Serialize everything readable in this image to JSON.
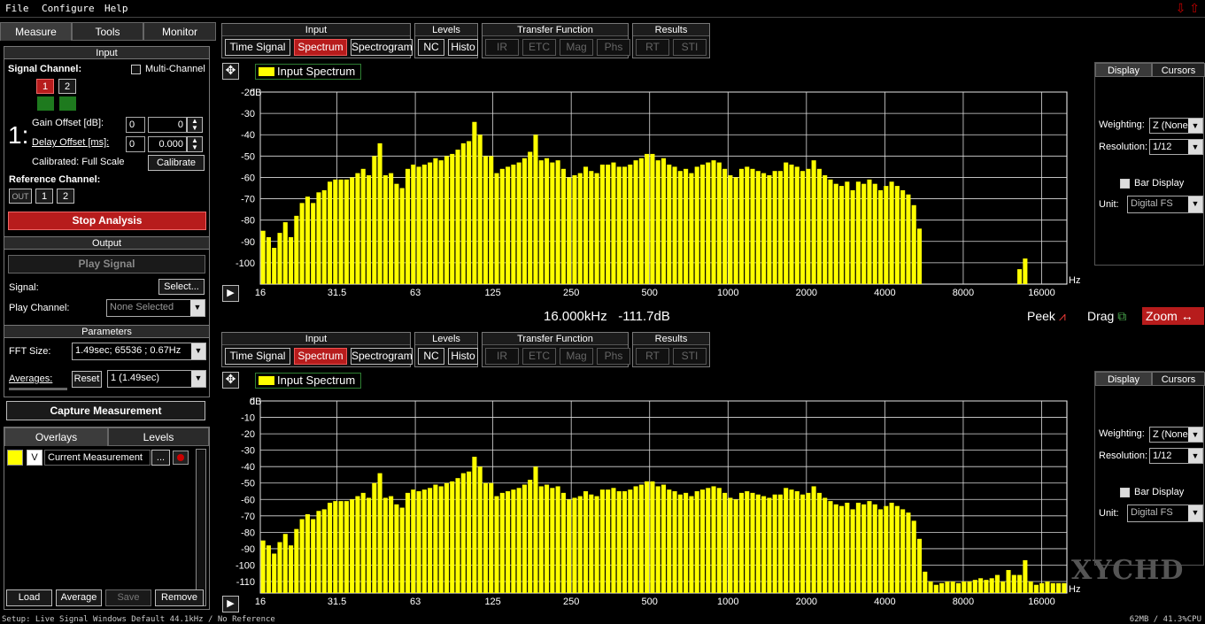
{
  "menu": [
    "File",
    "Configure",
    "Help"
  ],
  "left": {
    "tabs": [
      "Measure",
      "Tools",
      "Monitor"
    ],
    "input": {
      "header": "Input",
      "signal_channel": "Signal Channel:",
      "multi_channel": "Multi-Channel",
      "channels": [
        "1",
        "2"
      ],
      "channel_big": "1:",
      "gain_label": "Gain Offset [dB]:",
      "gain_a": "0",
      "gain_b": "0",
      "delay_label": "Delay Offset [ms]:",
      "delay_a": "0",
      "delay_b": "0.000",
      "calibrated": "Calibrated: Full Scale",
      "calibrate": "Calibrate",
      "reference_channel": "Reference Channel:",
      "ref_buttons": [
        "OUT",
        "1",
        "2"
      ],
      "stop": "Stop Analysis"
    },
    "output": {
      "header": "Output",
      "play": "Play Signal",
      "signal_label": "Signal:",
      "select": "Select...",
      "play_channel_label": "Play Channel:",
      "play_channel": "None Selected"
    },
    "parameters": {
      "header": "Parameters",
      "fft_label": "FFT Size:",
      "fft_value": "1.49sec; 65536 ; 0.67Hz",
      "averages_label": "Averages:",
      "reset": "Reset",
      "averages_value": "1  (1.49sec)",
      "capture": "Capture Measurement"
    },
    "overlays": {
      "tabs": [
        "Overlays",
        "Levels"
      ],
      "row_v": "V",
      "row_name": "Current Measurement",
      "row_more": "...",
      "buttons": [
        "Load",
        "Average",
        "Save",
        "Remove"
      ]
    }
  },
  "toolbar": {
    "groups": [
      {
        "title": "Input",
        "buttons": [
          {
            "label": "Time Signal",
            "state": "normal"
          },
          {
            "label": "Spectrum",
            "state": "on"
          },
          {
            "label": "Spectrogram",
            "state": "normal"
          }
        ]
      },
      {
        "title": "Levels",
        "buttons": [
          {
            "label": "NC",
            "state": "normal"
          },
          {
            "label": "Histo",
            "state": "normal"
          }
        ]
      },
      {
        "title": "Transfer Function",
        "buttons": [
          {
            "label": "IR",
            "state": "off"
          },
          {
            "label": "ETC",
            "state": "off"
          },
          {
            "label": "Mag",
            "state": "off"
          },
          {
            "label": "Phs",
            "state": "off"
          }
        ]
      },
      {
        "title": "Results",
        "buttons": [
          {
            "label": "RT",
            "state": "off"
          },
          {
            "label": "STI",
            "state": "off"
          }
        ]
      }
    ]
  },
  "right_panel": {
    "tabs": [
      "Display",
      "Cursors"
    ],
    "weighting_label": "Weighting:",
    "weighting": "Z (None)",
    "resolution_label": "Resolution:",
    "resolution": "1/12",
    "bar_display": "Bar Display",
    "unit_label": "Unit:",
    "unit": "Digital FS"
  },
  "readout": "16.000kHz   -111.7dB",
  "view_tools": {
    "peek": "Peek",
    "drag": "Drag",
    "zoom": "Zoom"
  },
  "watermark": "XYCHD",
  "status": {
    "left": "Setup: Live Signal Windows Default 44.1kHz / No Reference",
    "right": "62MB / 41.3%CPU"
  },
  "colors": {
    "bar": "#ffff00",
    "active": "#b71c1c",
    "legend_border": "#2e7d32"
  },
  "chart_data": [
    {
      "type": "bar",
      "legend": "Input Spectrum",
      "ylabel": "dB",
      "xlabel": "Hz",
      "x_scale": "log",
      "xlim": [
        16,
        20000
      ],
      "ylim": [
        -110,
        -20
      ],
      "y_ticks": [
        -20,
        -30,
        -40,
        -50,
        -60,
        -70,
        -80,
        -90,
        -100
      ],
      "x_ticks": [
        "16",
        "31.5",
        "63",
        "125",
        "250",
        "500",
        "1000",
        "2000",
        "4000",
        "8000",
        "16000"
      ],
      "x_tick_values": [
        16,
        31.5,
        63,
        125,
        250,
        500,
        1000,
        2000,
        4000,
        8000,
        16000
      ],
      "values": [
        -85,
        -88,
        -93,
        -86,
        -81,
        -88,
        -78,
        -72,
        -69,
        -72,
        -67,
        -66,
        -62,
        -61,
        -61,
        -61,
        -60,
        -58,
        -56,
        -59,
        -50,
        -44,
        -59,
        -58,
        -63,
        -65,
        -56,
        -54,
        -55,
        -54,
        -53,
        -51,
        -52,
        -50,
        -49,
        -47,
        -44,
        -43,
        -34,
        -40,
        -50,
        -50,
        -58,
        -56,
        -55,
        -54,
        -53,
        -51,
        -48,
        -40,
        -52,
        -51,
        -53,
        -52,
        -56,
        -60,
        -59,
        -58,
        -55,
        -57,
        -58,
        -54,
        -54,
        -53,
        -55,
        -55,
        -54,
        -52,
        -51,
        -49,
        -49,
        -52,
        -51,
        -54,
        -55,
        -57,
        -56,
        -58,
        -55,
        -54,
        -53,
        -52,
        -53,
        -56,
        -59,
        -60,
        -56,
        -55,
        -56,
        -57,
        -58,
        -59,
        -57,
        -57,
        -53,
        -54,
        -55,
        -57,
        -56,
        -52,
        -56,
        -59,
        -61,
        -63,
        -64,
        -62,
        -66,
        -62,
        -63,
        -61,
        -63,
        -66,
        -64,
        -62,
        -64,
        -66,
        -68,
        -73,
        -84,
        -110,
        -110,
        -110,
        -110,
        -110,
        -110,
        -110,
        -110,
        -110,
        -110,
        -110,
        -110,
        -110,
        -110,
        -110,
        -111,
        -111,
        -103,
        -98,
        -111,
        -111,
        -111,
        -111,
        -111,
        -111,
        -111
      ]
    },
    {
      "type": "bar",
      "legend": "Input Spectrum",
      "ylabel": "dB",
      "xlabel": "Hz",
      "x_scale": "log",
      "xlim": [
        16,
        20000
      ],
      "ylim": [
        -117,
        0
      ],
      "y_ticks": [
        0,
        -10,
        -20,
        -30,
        -40,
        -50,
        -60,
        -70,
        -80,
        -90,
        -100,
        -110
      ],
      "x_ticks": [
        "16",
        "31.5",
        "63",
        "125",
        "250",
        "500",
        "1000",
        "2000",
        "4000",
        "8000",
        "16000"
      ],
      "x_tick_values": [
        16,
        31.5,
        63,
        125,
        250,
        500,
        1000,
        2000,
        4000,
        8000,
        16000
      ],
      "values": [
        -85,
        -88,
        -93,
        -86,
        -81,
        -88,
        -78,
        -72,
        -69,
        -72,
        -67,
        -66,
        -62,
        -61,
        -61,
        -61,
        -60,
        -58,
        -56,
        -59,
        -50,
        -44,
        -59,
        -58,
        -63,
        -65,
        -56,
        -54,
        -55,
        -54,
        -53,
        -51,
        -52,
        -50,
        -49,
        -47,
        -44,
        -43,
        -34,
        -40,
        -50,
        -50,
        -58,
        -56,
        -55,
        -54,
        -53,
        -51,
        -48,
        -40,
        -52,
        -51,
        -53,
        -52,
        -56,
        -60,
        -59,
        -58,
        -55,
        -57,
        -58,
        -54,
        -54,
        -53,
        -55,
        -55,
        -54,
        -52,
        -51,
        -49,
        -49,
        -52,
        -51,
        -54,
        -55,
        -57,
        -56,
        -58,
        -55,
        -54,
        -53,
        -52,
        -53,
        -56,
        -59,
        -60,
        -56,
        -55,
        -56,
        -57,
        -58,
        -59,
        -57,
        -57,
        -53,
        -54,
        -55,
        -57,
        -56,
        -52,
        -56,
        -59,
        -61,
        -63,
        -64,
        -62,
        -66,
        -62,
        -63,
        -61,
        -63,
        -66,
        -64,
        -62,
        -64,
        -66,
        -68,
        -73,
        -84,
        -104,
        -110,
        -112,
        -111,
        -110,
        -110,
        -111,
        -110,
        -110,
        -109,
        -108,
        -109,
        -108,
        -106,
        -110,
        -103,
        -106,
        -106,
        -97,
        -110,
        -112,
        -111,
        -110,
        -111,
        -111,
        -111
      ]
    }
  ]
}
